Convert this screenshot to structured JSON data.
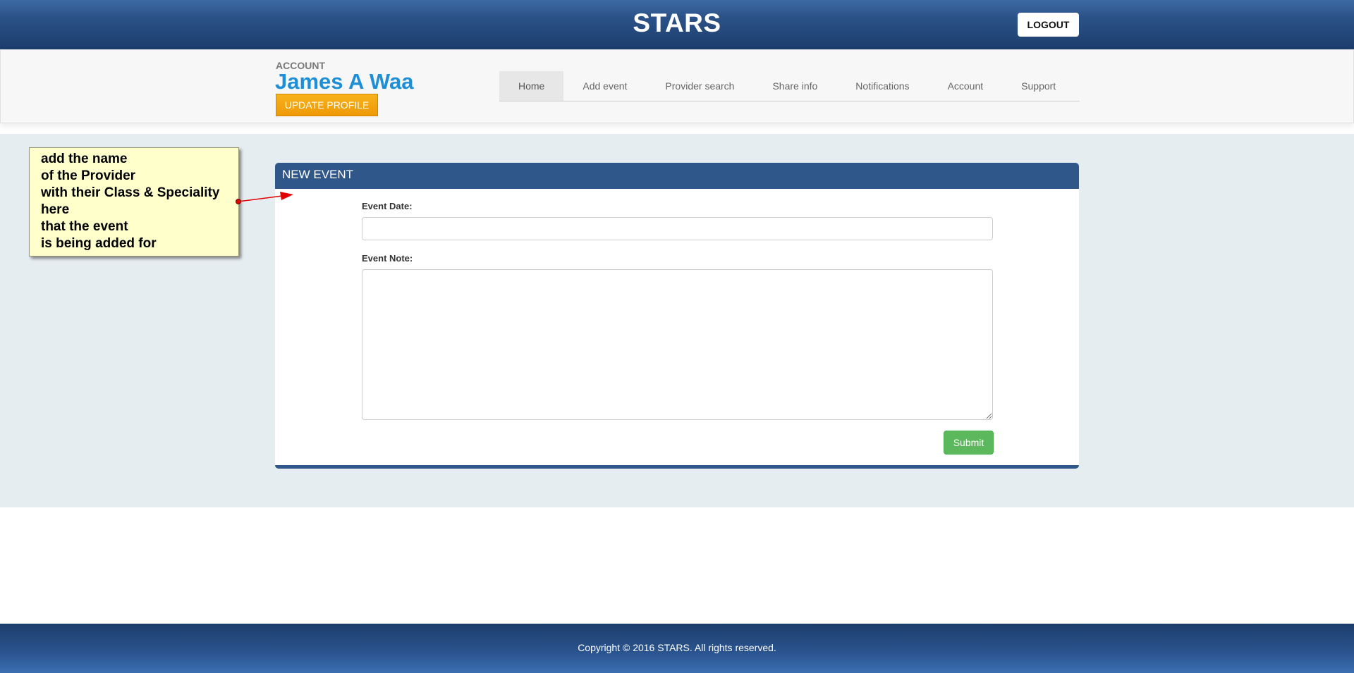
{
  "header": {
    "title": "STARS",
    "logout_label": "LOGOUT"
  },
  "account": {
    "label": "ACCOUNT",
    "name": "James A Waa",
    "update_label": "UPDATE PROFILE"
  },
  "nav": {
    "items": [
      {
        "label": "Home",
        "active": true
      },
      {
        "label": "Add event",
        "active": false
      },
      {
        "label": "Provider search",
        "active": false
      },
      {
        "label": "Share info",
        "active": false
      },
      {
        "label": "Notifications",
        "active": false
      },
      {
        "label": "Account",
        "active": false
      },
      {
        "label": "Support",
        "active": false
      }
    ]
  },
  "panel": {
    "title": "NEW EVENT",
    "date_label": "Event Date:",
    "date_value": "",
    "note_label": "Event Note:",
    "note_value": "",
    "submit_label": "Submit"
  },
  "annotation": {
    "lines": [
      "add the name",
      "of the Provider",
      "with their Class & Speciality",
      "here",
      "that the event",
      "is being added for"
    ]
  },
  "footer": {
    "copyright": "Copyright © 2016 STARS. All rights reserved."
  },
  "colors": {
    "header_blue": "#2b5288",
    "account_name": "#1e8fd6",
    "update_button": "#f0a20e",
    "panel_header": "#2f5789",
    "submit_button": "#5cb85c",
    "note_background": "#ffffcc",
    "arrow": "#e00000"
  }
}
